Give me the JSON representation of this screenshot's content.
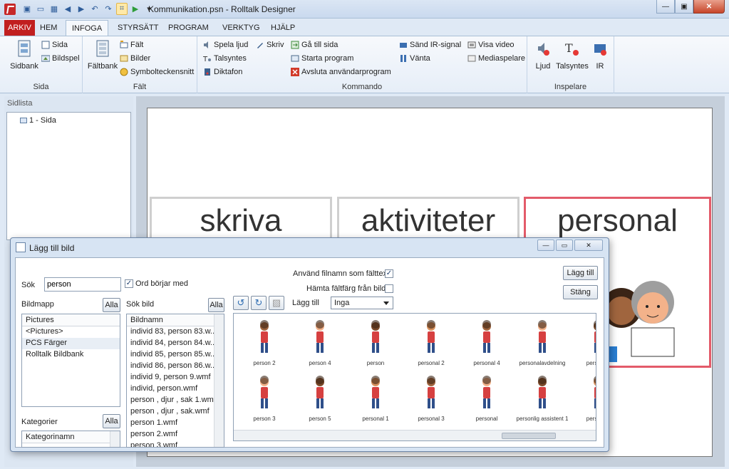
{
  "window": {
    "title": "Kommunikation.psn - Rolltalk Designer"
  },
  "tabs": [
    {
      "label": "ARKIV"
    },
    {
      "label": "HEM"
    },
    {
      "label": "INFOGA"
    },
    {
      "label": "STYRSÄTT"
    },
    {
      "label": "PROGRAM"
    },
    {
      "label": "VERKTYG"
    },
    {
      "label": "HJÄLP"
    }
  ],
  "ribbon": {
    "sida": {
      "label": "Sida",
      "sidbank": "Sidbank",
      "sida": "Sida",
      "bildspel": "Bildspel"
    },
    "falt": {
      "label": "Fält",
      "faltbank": "Fältbank",
      "falt": "Fält",
      "bilder": "Bilder",
      "symbol": "Symbolteckensnitt"
    },
    "kommando": {
      "label": "Kommando",
      "spela_ljud": "Spela ljud",
      "talsyntes": "Talsyntes",
      "diktafon": "Diktafon",
      "skriv": "Skriv",
      "ga_till_sida": "Gå till sida",
      "starta_program": "Starta program",
      "avsluta": "Avsluta användarprogram",
      "sand_ir": "Sänd IR-signal",
      "vanta": "Vänta",
      "visa_video": "Visa video",
      "mediaspelare": "Mediaspelare"
    },
    "inspelare": {
      "label": "Inspelare",
      "ljud": "Ljud",
      "talsyntes": "Talsyntes",
      "ir": "IR"
    }
  },
  "sidlist": {
    "title": "Sidlista",
    "item": "1 - Sida"
  },
  "cards": [
    {
      "text": "skriva"
    },
    {
      "text": "aktiviteter"
    },
    {
      "text": "personal"
    }
  ],
  "dialog": {
    "title": "Lägg till bild",
    "sok_label": "Sök",
    "sok_value": "person",
    "ord_borjar_med": "Ord börjar med",
    "anvand_filnamn": "Använd filnamn som fälttext",
    "hamta_faltfarg": "Hämta fältfärg från bild",
    "lagg_till_label": "Lägg till",
    "lagg_till_value": "Inga",
    "btn_lagg_till": "Lägg till",
    "btn_stang": "Stäng",
    "alla": "Alla",
    "bildmapp": "Bildmapp",
    "sok_bild": "Sök bild",
    "kategorier": "Kategorier",
    "folders_header": "Pictures",
    "folders": [
      "<Pictures>",
      "PCS Färger",
      "Rolltalk Bildbank"
    ],
    "bildnamn_header": "Bildnamn",
    "bildnamn": [
      "individ 83, person 83.w...",
      "individ 84, person 84.w...",
      "individ 85, person 85.w...",
      "individ 86, person 86.w...",
      "individ 9, person 9.wmf",
      "individ, person.wmf",
      "person , djur , sak 1.wmf",
      "person , djur , sak.wmf",
      "person 1.wmf",
      "person 2.wmf",
      "person 3.wmf"
    ],
    "kategorinamn_header": "Kategorinamn",
    "gallery_row1": [
      "person 2",
      "person 4",
      "person",
      "personal 2",
      "personal 4",
      "personalavdelning",
      "personlig"
    ],
    "gallery_row2": [
      "person 3",
      "person 5",
      "personal 1",
      "personal 3",
      "personal",
      "personlig assistent 1",
      "personlig"
    ]
  },
  "colors": {
    "accent_red": "#c11f1f",
    "selection": "#e35b6a"
  }
}
